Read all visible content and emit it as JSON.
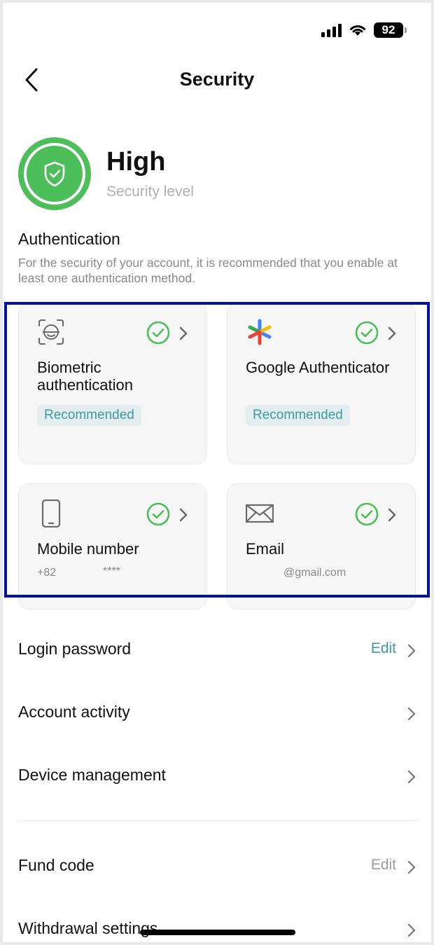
{
  "status_bar": {
    "battery": "92"
  },
  "nav": {
    "title": "Security"
  },
  "level": {
    "value": "High",
    "label": "Security level",
    "color": "#4cbe5a"
  },
  "auth": {
    "title": "Authentication",
    "description": "For the security of your account, it is recommended that you enable at least one authentication method."
  },
  "methods": [
    {
      "name": "Biometric authentication",
      "badge": "Recommended",
      "icon": "face-scan-icon"
    },
    {
      "name": "Google Authenticator",
      "badge": "Recommended",
      "icon": "google-authenticator-icon"
    },
    {
      "name": "Mobile number",
      "detail_prefix": "+82",
      "detail_mask": "****",
      "icon": "mobile-phone-icon"
    },
    {
      "name": "Email",
      "detail": "@gmail.com",
      "icon": "envelope-icon"
    }
  ],
  "settings": [
    {
      "label": "Login password",
      "action": "Edit",
      "action_color": "#3d9aa3"
    },
    {
      "label": "Account activity"
    },
    {
      "label": "Device management"
    },
    {
      "label": "Fund code",
      "action": "Edit",
      "action_color": "#9a9a9a"
    },
    {
      "label": "Withdrawal settings"
    }
  ],
  "colors": {
    "accent_green": "#4cbe5a",
    "accent_teal": "#3d9aa3",
    "highlight_border": "#0010a8"
  }
}
